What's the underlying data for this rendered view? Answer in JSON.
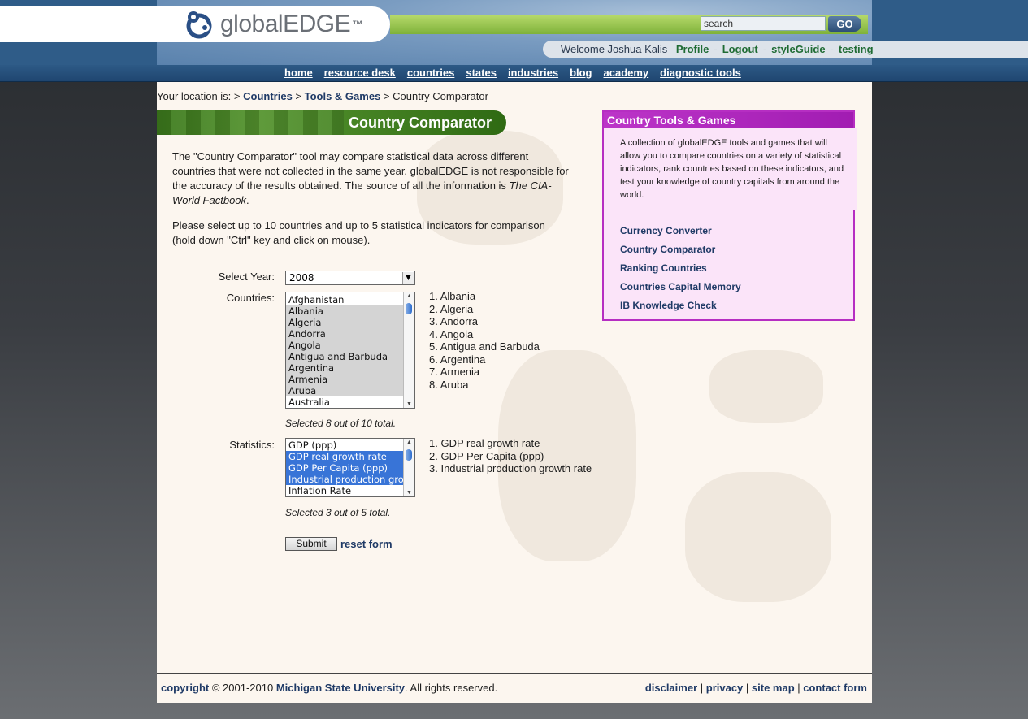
{
  "header": {
    "logo_text": "globalEDGE",
    "logo_tm": "™",
    "search_value": "search",
    "go_label": "GO",
    "welcome_text": "Welcome Joshua Kalis",
    "user_links": [
      "Profile",
      "Logout",
      "styleGuide",
      "testing"
    ],
    "separator": "-"
  },
  "nav": {
    "items": [
      "home",
      "resource desk",
      "countries",
      "states",
      "industries",
      "blog",
      "academy",
      "diagnostic tools"
    ]
  },
  "breadcrumb": {
    "prefix": "Your location is: > ",
    "items": [
      "Countries",
      "Tools & Games"
    ],
    "current": "Country Comparator",
    "sep": " > "
  },
  "page": {
    "title": "Country Comparator",
    "intro_part1": "The \"Country Comparator\" tool may compare statistical data across different countries that were not collected in the same year. globalEDGE is not responsible for the accuracy of the results obtained. The source of all the information is ",
    "intro_source": "The CIA-World Factbook",
    "intro_end": ".",
    "instructions": "Please select up to 10 countries and up to 5 statistical indicators for comparison (hold down \"Ctrl\" key and click on mouse)."
  },
  "form": {
    "year_label": "Select Year:",
    "year_value": "2008",
    "countries_label": "Countries:",
    "country_options": [
      "Afghanistan",
      "Albania",
      "Algeria",
      "Andorra",
      "Angola",
      "Antigua and Barbuda",
      "Argentina",
      "Armenia",
      "Aruba",
      "Australia"
    ],
    "selected_countries": [
      "1. Albania",
      "2. Algeria",
      "3. Andorra",
      "4. Angola",
      "5. Antigua and Barbuda",
      "6. Argentina",
      "7. Armenia",
      "8. Aruba"
    ],
    "countries_note": "Selected 8 out of 10 total.",
    "statistics_label": "Statistics:",
    "statistic_options": [
      "GDP (ppp)",
      "GDP real growth rate",
      "GDP Per Capita (ppp)",
      "Industrial production grow",
      "Inflation Rate"
    ],
    "selected_statistics": [
      "1. GDP real growth rate",
      "2. GDP Per Capita (ppp)",
      "3. Industrial production growth rate"
    ],
    "statistics_note": "Selected 3 out of 5 total.",
    "submit_label": "Submit",
    "reset_label": "reset form"
  },
  "sidebar": {
    "title": "Country Tools & Games",
    "description": "A collection of globalEDGE tools and games that will allow you to compare countries on a variety of statistical indicators, rank countries based on these indicators, and test your knowledge of country capitals from around the world.",
    "links": [
      "Currency Converter",
      "Country Comparator",
      "Ranking Countries",
      "Countries Capital Memory",
      "IB Knowledge Check"
    ]
  },
  "footer": {
    "copyright_word": "copyright",
    "copyright_text": " © 2001-2010 ",
    "institution": "Michigan State University",
    "rights": ". All rights reserved.",
    "links": [
      "disclaimer",
      "privacy",
      "site map",
      "contact form"
    ],
    "link_sep": " | "
  },
  "colors": {
    "accent_green": "#1f6b34",
    "link_blue": "#1f3a66",
    "sidebar_purple": "#b62ec2",
    "selection_blue": "#3874d7"
  }
}
